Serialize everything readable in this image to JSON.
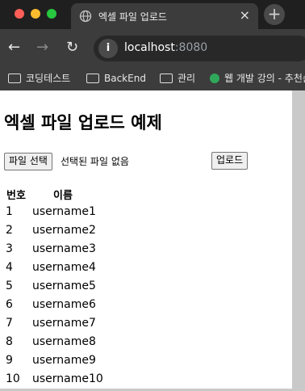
{
  "browser": {
    "tab": {
      "title": "엑셀 파일 업로드",
      "close_symbol": "×"
    },
    "new_tab_symbol": "+",
    "nav": {
      "back": "←",
      "forward": "→",
      "reload": "↻"
    },
    "address": {
      "host": "localhost",
      "port": ":8080",
      "site_info_symbol": "i"
    },
    "bookmarks": [
      {
        "label": "코딩테스트",
        "icon": "folder-icon"
      },
      {
        "label": "BackEnd",
        "icon": "folder-icon"
      },
      {
        "label": "관리",
        "icon": "folder-icon"
      },
      {
        "label": "웹 개발 강의 - 추천순",
        "icon": "site-favicon-icon"
      }
    ]
  },
  "page": {
    "heading": "엑셀 파일 업로드 예제",
    "file_input": {
      "button_label": "파일 선택",
      "status": "선택된 파일 없음"
    },
    "upload_label": "업로드",
    "table": {
      "headers": [
        "번호",
        "이름"
      ],
      "rows": [
        {
          "num": "1",
          "name": "username1"
        },
        {
          "num": "2",
          "name": "username2"
        },
        {
          "num": "3",
          "name": "username3"
        },
        {
          "num": "4",
          "name": "username4"
        },
        {
          "num": "5",
          "name": "username5"
        },
        {
          "num": "6",
          "name": "username6"
        },
        {
          "num": "7",
          "name": "username7"
        },
        {
          "num": "8",
          "name": "username8"
        },
        {
          "num": "9",
          "name": "username9"
        },
        {
          "num": "10",
          "name": "username10"
        }
      ]
    }
  },
  "colors": {
    "tab_strip": "#1f1f1f",
    "toolbar": "#3c3c3c",
    "omnibox": "#282828",
    "page_background": "#ffffff",
    "window_backdrop": "#c9c9c9"
  }
}
